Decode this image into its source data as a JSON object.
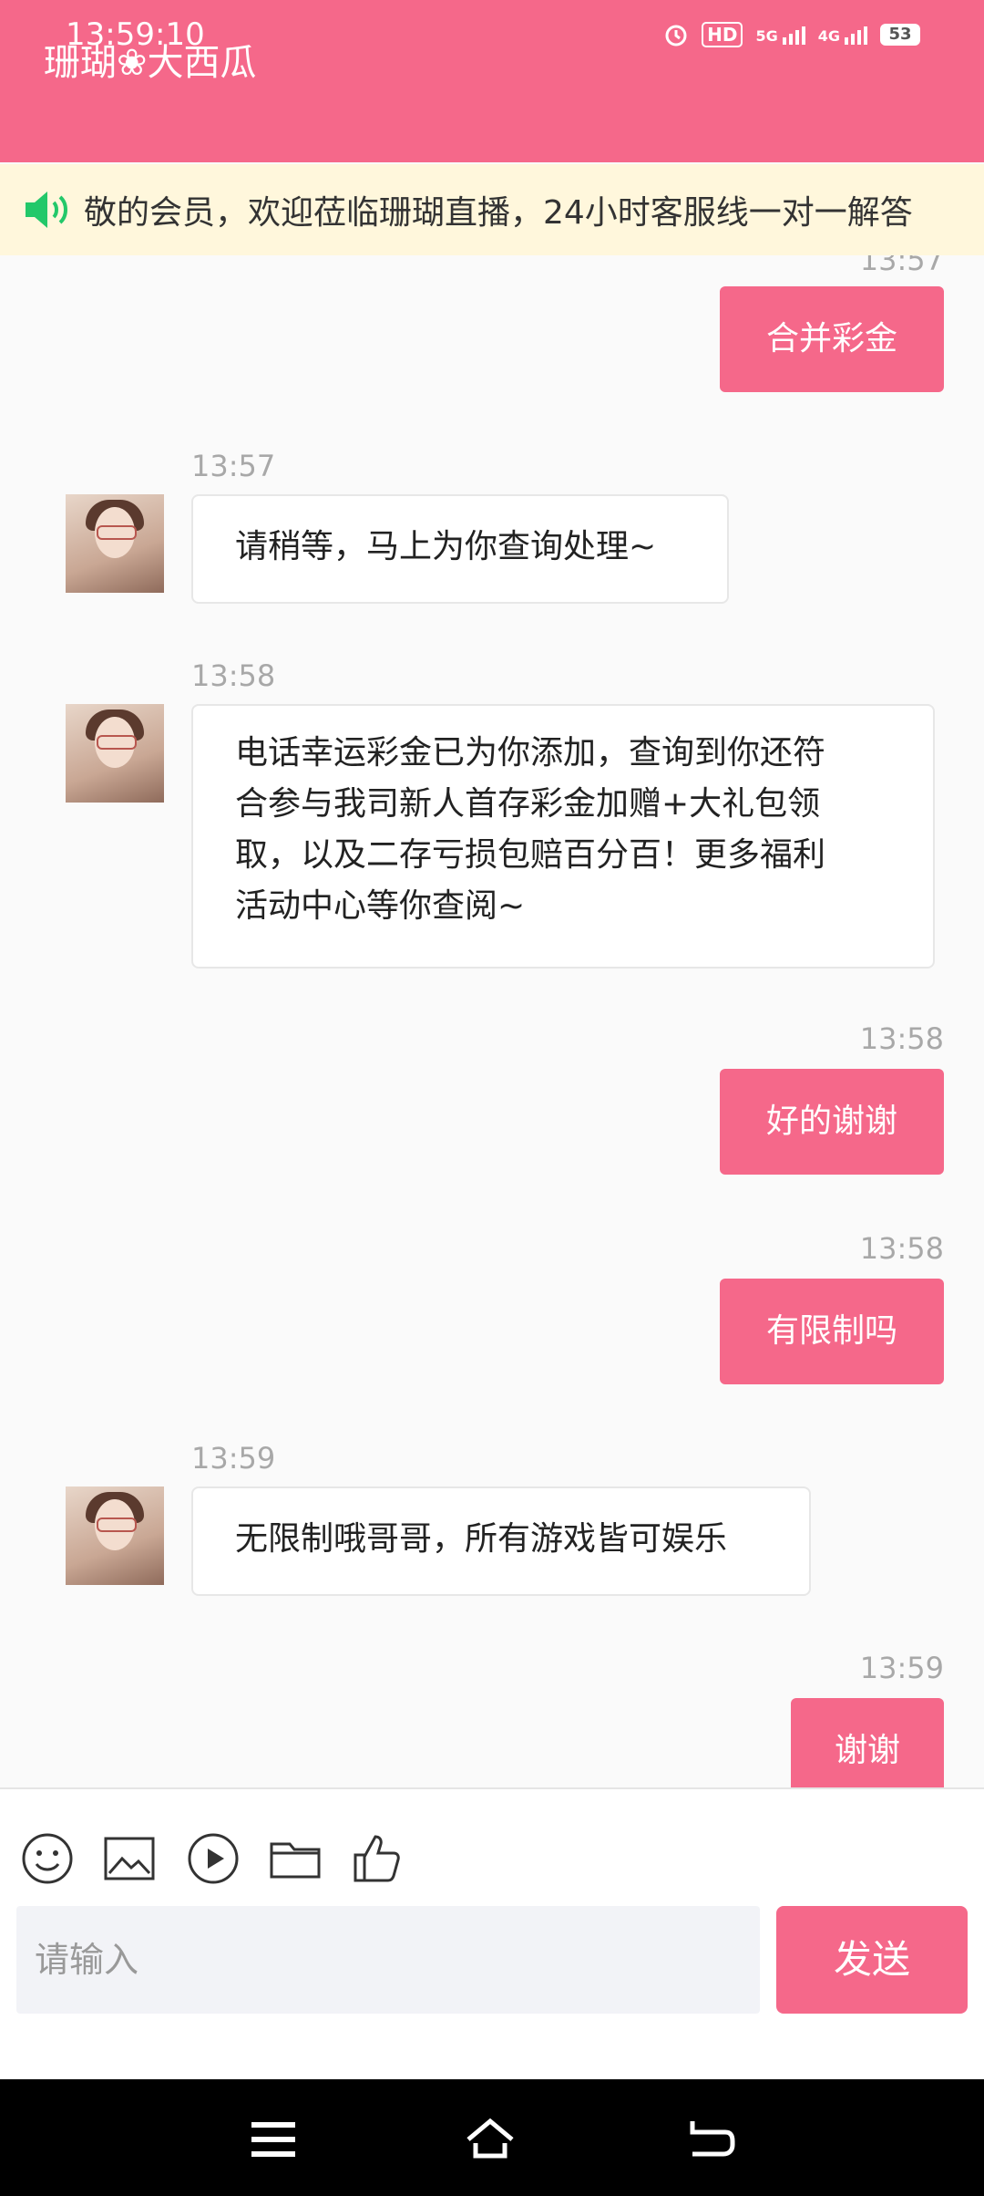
{
  "status_bar": {
    "time": "13:59:10",
    "battery": "53"
  },
  "header": {
    "title": "珊瑚❀大西瓜"
  },
  "notice": {
    "text": "敬的会员，欢迎莅临珊瑚直播，24小时客服线一对一解答"
  },
  "messages": [
    {
      "side": "right",
      "time": "13:57",
      "text": "合并彩金"
    },
    {
      "side": "left",
      "time": "13:57",
      "text": "请稍等，马上为你查询处理~"
    },
    {
      "side": "left",
      "time": "13:58",
      "lines": [
        "电话幸运彩金已为你添加，查询到你还符",
        "合参与我司新人首存彩金加赠+大礼包领",
        "取，以及二存亏损包赔百分百！更多福利",
        "活动中心等你查阅~"
      ]
    },
    {
      "side": "right",
      "time": "13:58",
      "text": "好的谢谢"
    },
    {
      "side": "right",
      "time": "13:58",
      "text": "有限制吗"
    },
    {
      "side": "left",
      "time": "13:59",
      "text": "无限制哦哥哥，所有游戏皆可娱乐"
    },
    {
      "side": "right",
      "time": "13:59",
      "text": "谢谢"
    }
  ],
  "toolbar": {
    "icons": [
      "emoji-icon",
      "image-icon",
      "video-icon",
      "folder-icon",
      "like-icon"
    ],
    "input_placeholder": "请输入",
    "send_label": "发送"
  },
  "colors": {
    "brand": "#f5688a",
    "notice_bg": "#fff7dc"
  }
}
